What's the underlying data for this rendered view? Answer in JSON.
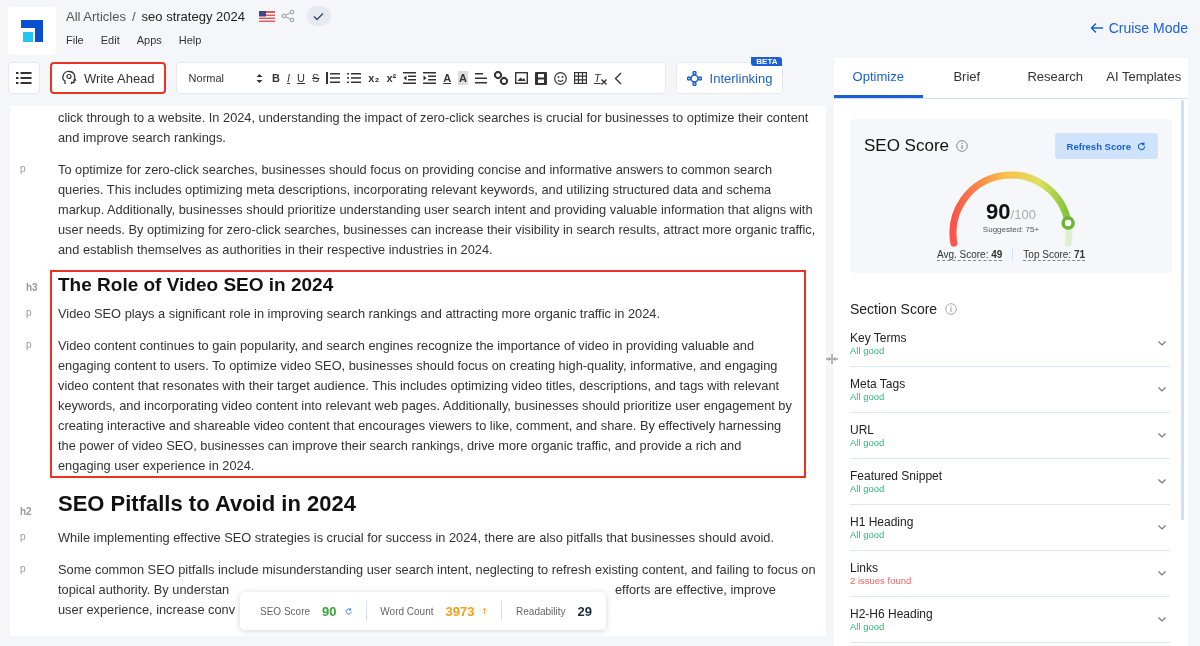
{
  "header": {
    "breadcrumb_root": "All Articles",
    "separator": "/",
    "article_title": "seo strategy 2024",
    "published": true,
    "menu": [
      "File",
      "Edit",
      "Apps",
      "Help"
    ],
    "cruise_mode": "Cruise Mode"
  },
  "toolbar": {
    "write_ahead": "Write Ahead",
    "write_ahead_highlighted": true,
    "style": "Normal",
    "bold": "B",
    "italic": "I",
    "underline": "U",
    "strike": "S",
    "subscript": "x₂",
    "superscript": "x²",
    "text_color": "A",
    "highlight": "A",
    "clear_format": "T",
    "interlinking": "Interlinking",
    "interlinking_badge": "BETA"
  },
  "editor": {
    "sections": [
      {
        "highlighted": false,
        "blocks": [
          {
            "kind": "p",
            "text": "click through to a website. In 2024, understanding the impact of zero-click searches is crucial for businesses to optimize their content and improve search rankings."
          },
          {
            "kind": "p",
            "tag": "p",
            "text": "To optimize for zero-click searches, businesses should focus on providing concise and informative answers to common search queries. This includes optimizing meta descriptions, incorporating relevant keywords, and utilizing structured data and schema markup. Additionally, businesses should prioritize understanding user search intent and providing valuable information that aligns with user needs. By optimizing for zero-click searches, businesses can increase their visibility in search results, attract more organic traffic, and establish themselves as authorities in their respective industries in 2024."
          }
        ]
      },
      {
        "highlighted": true,
        "blocks": [
          {
            "kind": "h3",
            "tag": "h3",
            "text": "The Role of Video SEO in 2024"
          },
          {
            "kind": "p",
            "tag": "p",
            "text": "Video SEO plays a significant role in improving search rankings and attracting more organic traffic in 2024."
          },
          {
            "kind": "p",
            "tag": "p",
            "text": "Video content continues to gain popularity, and search engines recognize the importance of video in providing valuable and engaging content to users. To optimize video SEO, businesses should focus on creating high-quality, informative, and engaging video content that resonates with their target audience. This includes optimizing video titles, descriptions, and tags with relevant keywords, and incorporating video content into relevant web pages. Additionally, businesses should prioritize user engagement by creating interactive and shareable video content that encourages viewers to like, comment, and share. By effectively harnessing the power of video SEO, businesses can improve their search rankings, drive more organic traffic, and provide a rich and engaging user experience in 2024."
          }
        ]
      },
      {
        "highlighted": false,
        "blocks": [
          {
            "kind": "h2",
            "tag": "h2",
            "text": "SEO Pitfalls to Avoid in 2024"
          },
          {
            "kind": "p",
            "tag": "p",
            "text": "While implementing effective SEO strategies is crucial for success in 2024, there are also pitfalls that businesses should avoid."
          },
          {
            "kind": "covered",
            "tag": "p",
            "lines": [
              {
                "left": "Some common SEO pitfalls include misunderstanding user search intent, neglecting to refresh existing content, and failing to focus on"
              },
              {
                "left": "topical authority. By understan",
                "right": "efforts are effective, improve"
              },
              {
                "left": "user experience, increase conv"
              }
            ]
          }
        ]
      }
    ]
  },
  "score_bar": {
    "seo_label": "SEO Score",
    "seo_value": "90",
    "word_label": "Word Count",
    "word_value": "3973",
    "word_rising": true,
    "read_label": "Readability",
    "read_value": "29"
  },
  "panel": {
    "tabs": [
      {
        "label": "Optimize",
        "selected": true
      },
      {
        "label": "Brief",
        "selected": false
      },
      {
        "label": "Research",
        "selected": false
      },
      {
        "label": "AI Templates",
        "selected": false
      }
    ],
    "seo_title": "SEO Score",
    "refresh": "Refresh Score",
    "gauge": {
      "level": 0.9,
      "score": "90",
      "max": "/100",
      "suggested": "Suggested: 75+"
    },
    "avg_label": "Avg. Score:",
    "avg_value": "49",
    "top_label": "Top Score:",
    "top_value": "71",
    "section_title": "Section Score",
    "sections": [
      {
        "name": "Key Terms",
        "status": "All good",
        "ok": true
      },
      {
        "name": "Meta Tags",
        "status": "All good",
        "ok": true
      },
      {
        "name": "URL",
        "status": "All good",
        "ok": true
      },
      {
        "name": "Featured Snippet",
        "status": "All good",
        "ok": true
      },
      {
        "name": "H1 Heading",
        "status": "All good",
        "ok": true
      },
      {
        "name": "Links",
        "status": "2 issues found",
        "ok": false
      },
      {
        "name": "H2-H6 Heading",
        "status": "All good",
        "ok": true
      }
    ]
  }
}
